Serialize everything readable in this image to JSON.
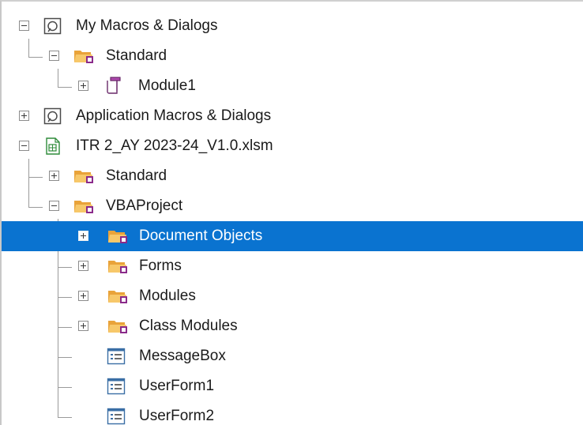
{
  "tree": {
    "items": [
      {
        "label": "My Macros & Dialogs",
        "icon": "library-icon",
        "state": "expanded"
      },
      {
        "label": "Standard",
        "icon": "basic-library-folder-icon",
        "state": "expanded"
      },
      {
        "label": "Module1",
        "icon": "module-icon",
        "state": "collapsed"
      },
      {
        "label": "Application Macros & Dialogs",
        "icon": "library-icon",
        "state": "collapsed"
      },
      {
        "label": "ITR 2_AY 2023-24_V1.0.xlsm",
        "icon": "spreadsheet-document-icon",
        "state": "expanded"
      },
      {
        "label": "Standard",
        "icon": "basic-library-folder-icon",
        "state": "collapsed"
      },
      {
        "label": "VBAProject",
        "icon": "basic-library-folder-icon",
        "state": "expanded"
      },
      {
        "label": "Document Objects",
        "icon": "basic-library-folder-icon",
        "state": "collapsed",
        "selected": true
      },
      {
        "label": "Forms",
        "icon": "basic-library-folder-icon",
        "state": "collapsed"
      },
      {
        "label": "Modules",
        "icon": "basic-library-folder-icon",
        "state": "collapsed"
      },
      {
        "label": "Class Modules",
        "icon": "basic-library-folder-icon",
        "state": "collapsed"
      },
      {
        "label": "MessageBox",
        "icon": "dialog-icon",
        "state": "leaf"
      },
      {
        "label": "UserForm1",
        "icon": "dialog-icon",
        "state": "leaf"
      },
      {
        "label": "UserForm2",
        "icon": "dialog-icon",
        "state": "leaf"
      }
    ]
  },
  "colors": {
    "selection": "#0a73d0",
    "folder": "#f5b94a",
    "badge": "#8a2a8a",
    "spreadsheet": "#2e8b3a"
  }
}
